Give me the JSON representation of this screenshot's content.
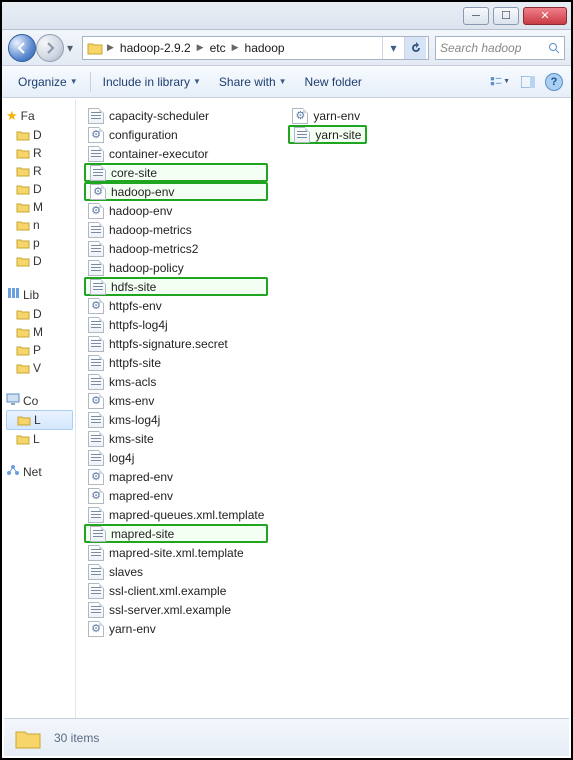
{
  "breadcrumb": {
    "p1": "hadoop-2.9.2",
    "p2": "etc",
    "p3": "hadoop"
  },
  "search": {
    "placeholder": "Search hadoop"
  },
  "toolbar": {
    "organize": "Organize",
    "include": "Include in library",
    "share": "Share with",
    "newfolder": "New folder"
  },
  "sidebar": {
    "fav": "Fa",
    "favitems": [
      "D",
      "R",
      "R",
      "D",
      "M",
      "n",
      "p",
      "D"
    ],
    "lib": "Lib",
    "libitems": [
      "D",
      "M",
      "P",
      "V"
    ],
    "co": "Co",
    "coitems": [
      "L",
      "L"
    ],
    "net": "Net"
  },
  "files_col1": [
    {
      "name": "capacity-scheduler",
      "t": "doc",
      "hl": false
    },
    {
      "name": "configuration",
      "t": "gear",
      "hl": false
    },
    {
      "name": "container-executor",
      "t": "doc",
      "hl": false
    },
    {
      "name": "core-site",
      "t": "doc",
      "hl": true
    },
    {
      "name": "hadoop-env",
      "t": "gear",
      "hl": true
    },
    {
      "name": "hadoop-env",
      "t": "gear",
      "hl": false
    },
    {
      "name": "hadoop-metrics",
      "t": "doc",
      "hl": false
    },
    {
      "name": "hadoop-metrics2",
      "t": "doc",
      "hl": false
    },
    {
      "name": "hadoop-policy",
      "t": "doc",
      "hl": false
    },
    {
      "name": "hdfs-site",
      "t": "doc",
      "hl": true
    },
    {
      "name": "httpfs-env",
      "t": "gear",
      "hl": false
    },
    {
      "name": "httpfs-log4j",
      "t": "doc",
      "hl": false
    },
    {
      "name": "httpfs-signature.secret",
      "t": "doc",
      "hl": false
    },
    {
      "name": "httpfs-site",
      "t": "doc",
      "hl": false
    },
    {
      "name": "kms-acls",
      "t": "doc",
      "hl": false
    },
    {
      "name": "kms-env",
      "t": "gear",
      "hl": false
    },
    {
      "name": "kms-log4j",
      "t": "doc",
      "hl": false
    },
    {
      "name": "kms-site",
      "t": "doc",
      "hl": false
    },
    {
      "name": "log4j",
      "t": "doc",
      "hl": false
    },
    {
      "name": "mapred-env",
      "t": "gear",
      "hl": false
    },
    {
      "name": "mapred-env",
      "t": "gear",
      "hl": false
    },
    {
      "name": "mapred-queues.xml.template",
      "t": "doc",
      "hl": false
    },
    {
      "name": "mapred-site",
      "t": "doc",
      "hl": true
    },
    {
      "name": "mapred-site.xml.template",
      "t": "doc",
      "hl": false
    },
    {
      "name": "slaves",
      "t": "doc",
      "hl": false
    },
    {
      "name": "ssl-client.xml.example",
      "t": "doc",
      "hl": false
    },
    {
      "name": "ssl-server.xml.example",
      "t": "doc",
      "hl": false
    },
    {
      "name": "yarn-env",
      "t": "gear",
      "hl": false
    }
  ],
  "files_col2": [
    {
      "name": "yarn-env",
      "t": "gear",
      "hl": false
    },
    {
      "name": "yarn-site",
      "t": "doc",
      "hl": true
    }
  ],
  "status": {
    "count": "30 items"
  }
}
